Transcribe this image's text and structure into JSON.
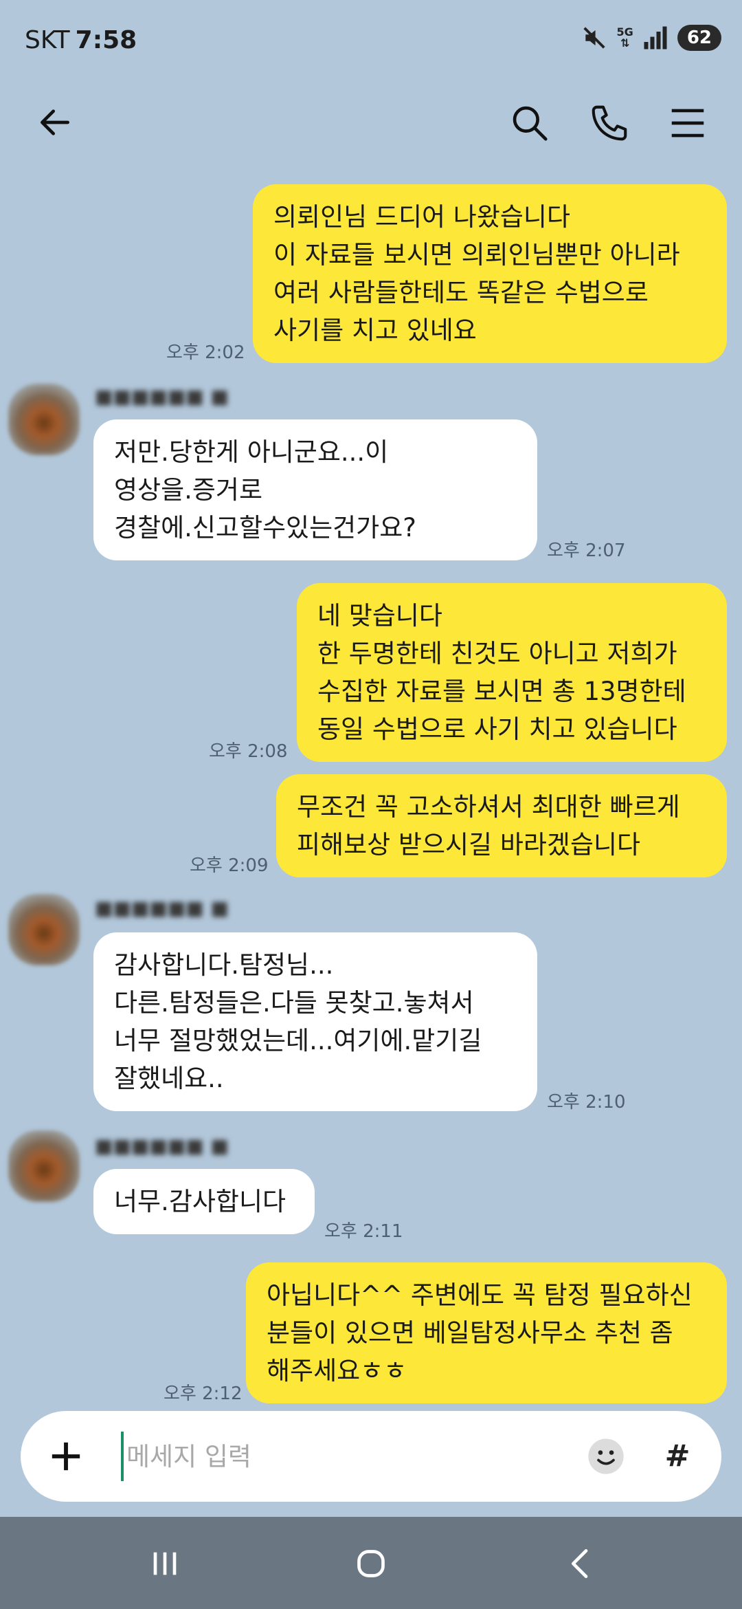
{
  "status_bar": {
    "carrier": "SKT",
    "time": "7:58",
    "network": "5G",
    "battery": "62"
  },
  "header": {
    "title": "",
    "icons": [
      "back-icon",
      "search-icon",
      "phone-icon",
      "menu-icon"
    ]
  },
  "messages": [
    {
      "side": "mine",
      "lines": [
        "의뢰인님 드디어 나왔습니다",
        "이 자료들 보시면 의뢰인님뿐만 아니라",
        "여러 사람들한테도 똑같은 수법으로",
        "사기를 치고 있네요"
      ],
      "time": "오후 2:02"
    },
    {
      "side": "theirs",
      "lines": [
        "저만.당한게 아니군요...이",
        "영상을.증거로",
        "경찰에.신고할수있는건가요?"
      ],
      "time": "오후 2:07"
    },
    {
      "side": "mine",
      "lines": [
        "네 맞습니다",
        "한 두명한테 친것도 아니고 저희가",
        "수집한 자료를 보시면 총 13명한테",
        "동일 수법으로 사기 치고 있습니다"
      ],
      "time": "오후 2:08"
    },
    {
      "side": "mine",
      "lines": [
        "무조건 꼭 고소하셔서 최대한 빠르게",
        "피해보상 받으시길 바라겠습니다"
      ],
      "time": "오후 2:09"
    },
    {
      "side": "theirs",
      "lines": [
        "감사합니다.탐정님...",
        "다른.탐정들은.다들 못찾고.놓쳐서",
        "너무 절망했었는데...여기에.맡기길",
        "잘했네요.."
      ],
      "time": "오후 2:10"
    },
    {
      "side": "theirs",
      "lines": [
        "너무.감사합니다"
      ],
      "time": "오후 2:11"
    },
    {
      "side": "mine",
      "lines": [
        "아닙니다^^ 주변에도 꼭 탐정 필요하신",
        "분들이 있으면 베일탐정사무소 추천 좀",
        "해주세요ㅎㅎ"
      ],
      "time": "오후 2:12"
    }
  ],
  "input": {
    "placeholder": "메세지 입력",
    "hash_label": "#"
  },
  "colors": {
    "background": "#b2c7da",
    "my_bubble": "#fde839",
    "their_bubble": "#ffffff",
    "navbar": "#6a7783"
  }
}
